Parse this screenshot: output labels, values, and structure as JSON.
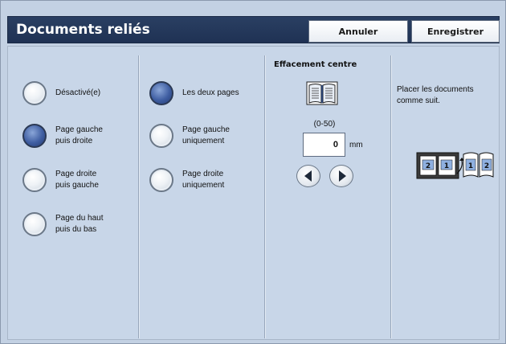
{
  "header": {
    "title": "Documents reliés",
    "cancel_label": "Annuler",
    "save_label": "Enregistrer"
  },
  "column1": {
    "options": [
      {
        "label": "Désactivé(e)",
        "selected": false
      },
      {
        "label": "Page gauche\npuis droite",
        "selected": true
      },
      {
        "label": "Page droite\npuis gauche",
        "selected": false
      },
      {
        "label": "Page du haut\npuis du bas",
        "selected": false
      }
    ]
  },
  "column2": {
    "options": [
      {
        "label": "Les deux pages",
        "selected": true
      },
      {
        "label": "Page gauche\nuniquement",
        "selected": false
      },
      {
        "label": "Page droite\nuniquement",
        "selected": false
      }
    ]
  },
  "center_erase": {
    "title": "Effacement centre",
    "range": "(0-50)",
    "value": "0",
    "unit": "mm"
  },
  "instructions": {
    "text": "Placer les documents comme suit."
  },
  "icons": {
    "book": "open-book-icon",
    "left_arrow": "decrement-arrow-icon",
    "right_arrow": "increment-arrow-icon",
    "illustration": "document-placement-illustration"
  },
  "colors": {
    "title_bar": "#1f3254",
    "panel": "#c8d6e8",
    "selected_radio": "#3f5ea2"
  }
}
